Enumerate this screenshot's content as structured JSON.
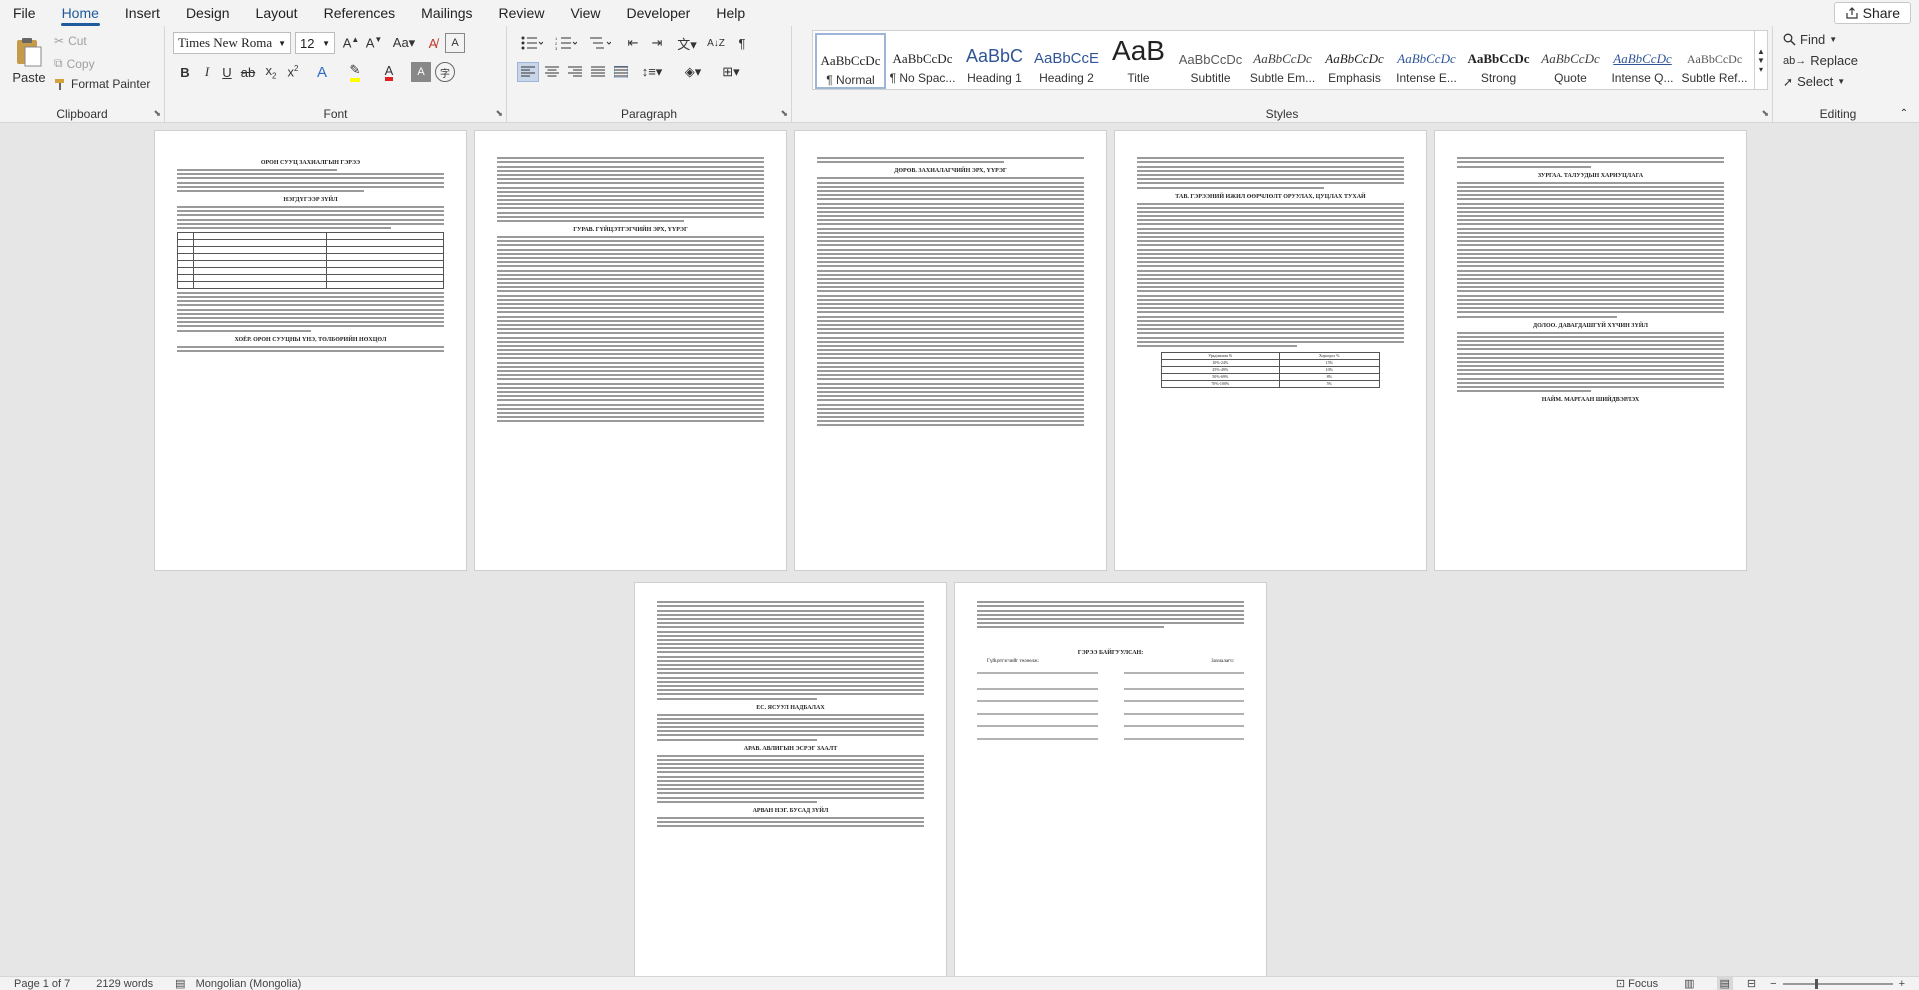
{
  "menu": {
    "items": [
      "File",
      "Home",
      "Insert",
      "Design",
      "Layout",
      "References",
      "Mailings",
      "Review",
      "View",
      "Developer",
      "Help"
    ],
    "active": "Home",
    "share_label": "Share"
  },
  "clipboard": {
    "group_label": "Clipboard",
    "paste_label": "Paste",
    "cut_label": "Cut",
    "copy_label": "Copy",
    "format_painter_label": "Format Painter"
  },
  "font": {
    "group_label": "Font",
    "font_name": "Times New Roma",
    "font_size": "12"
  },
  "paragraph": {
    "group_label": "Paragraph"
  },
  "styles": {
    "group_label": "Styles",
    "items": [
      {
        "preview": "AaBbCcDc",
        "name": "¶ Normal"
      },
      {
        "preview": "AaBbCcDc",
        "name": "¶ No Spac..."
      },
      {
        "preview": "AaBbC",
        "name": "Heading 1"
      },
      {
        "preview": "AaBbCcE",
        "name": "Heading 2"
      },
      {
        "preview": "AaB",
        "name": "Title"
      },
      {
        "preview": "AaBbCcDc",
        "name": "Subtitle"
      },
      {
        "preview": "AaBbCcDc",
        "name": "Subtle Em..."
      },
      {
        "preview": "AaBbCcDc",
        "name": "Emphasis"
      },
      {
        "preview": "AaBbCcDc",
        "name": "Intense E..."
      },
      {
        "preview": "AaBbCcDc",
        "name": "Strong"
      },
      {
        "preview": "AaBbCcDc",
        "name": "Quote"
      },
      {
        "preview": "AaBbCcDc",
        "name": "Intense Q..."
      },
      {
        "preview": "AaBbCcDc",
        "name": "Subtle Ref..."
      }
    ]
  },
  "editing": {
    "group_label": "Editing",
    "find_label": "Find",
    "replace_label": "Replace",
    "select_label": "Select"
  },
  "pages": {
    "p1_heading": "ОРОН СУУЦ ЗАХИАЛГЫН ГЭРЭЭ",
    "p1_heading2": "НЭГДҮГЭЭР ЗҮЙЛ",
    "p1_heading3": "ХОЁР. ОРОН СУУЦНЫ ҮНЭ, ТӨЛБӨРИЙН НӨХЦӨЛ",
    "p2_heading": "ГУРАВ. ГҮЙЦЭТГЭГЧИЙН ЭРХ, ҮҮРЭГ",
    "p3_heading": "ДӨРӨВ. ЗАХИАЛАГЧИЙН ЭРХ, ҮҮРЭГ",
    "p4_heading": "ТАВ. ГЭРЭЭНИЙ ИЖИЛ ӨӨРЧЛӨЛТ ОРУУЛАХ, ЦУЦЛАХ ТУХАЙ",
    "p4_table_header": [
      "Урьдчилгаа %",
      "Хорогдол %"
    ],
    "p4_table_rows": [
      [
        "10%-24%",
        "15%"
      ],
      [
        "25%-49%",
        "10%"
      ],
      [
        "50%-69%",
        "8%"
      ],
      [
        "70%-100%",
        "5%"
      ]
    ],
    "p5_heading": "ЗУРГАА. ТАЛУУДЫН ХАРИУЦЛАГА",
    "p5_heading2": "ДОЛОО. ДАВАГДАШГҮЙ ХҮЧИН ЗҮЙЛ",
    "p5_heading3": "НАЙМ. МАРГААН ШИЙДВЭРЛЭХ",
    "p6_heading": "ЕС. ЯСУУЛ НАДБАЛАХ",
    "p6_heading2": "АРАВ. АВЛИГЫН ЭСРЭГ ЗААЛТ",
    "p6_heading3": "АРВАН НЭГ. БУСАД ЗҮЙЛ",
    "p7_heading": "ГЭРЭЭ БАЙГУУЛСАН:",
    "p7_left_party": "Гүйцэтгэгчийг төлөөлж:",
    "p7_right_party": "Захиалагч:"
  },
  "status": {
    "page": "Page 1 of 7",
    "words": "2129 words",
    "language": "Mongolian (Mongolia)",
    "focus": "Focus"
  }
}
